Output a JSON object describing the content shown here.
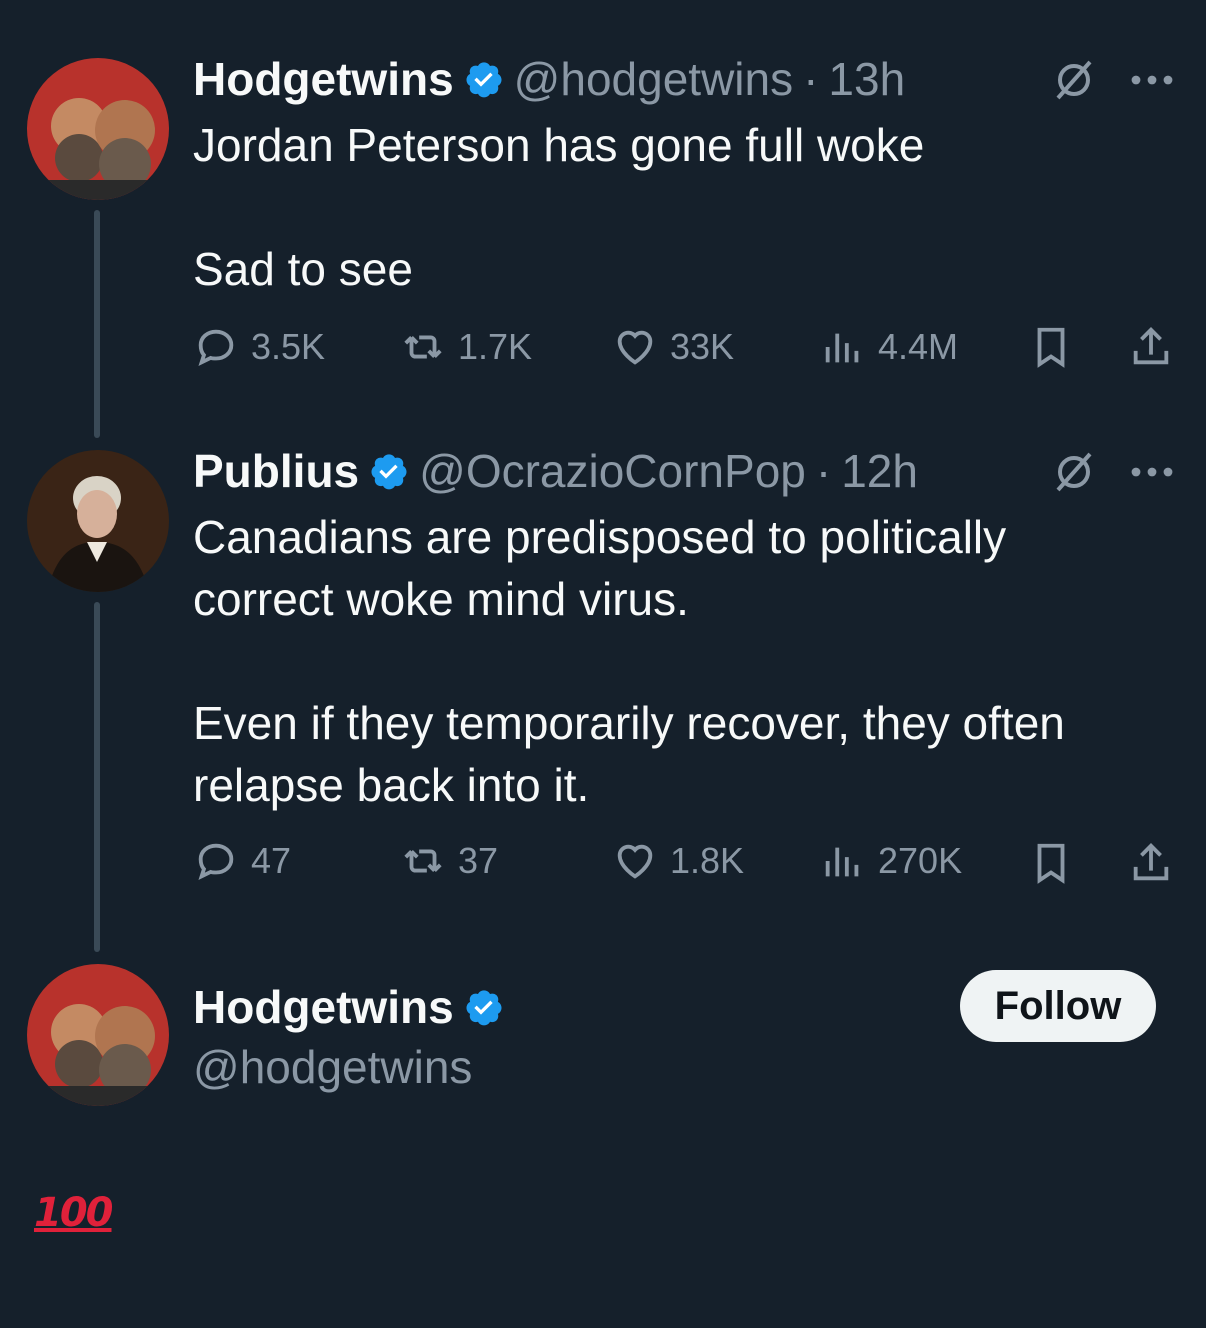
{
  "tweets": [
    {
      "name": "Hodgetwins",
      "handle": "@hodgetwins",
      "time": "13h",
      "text": "Jordan Peterson has gone full woke\n\nSad to see",
      "replies": "3.5K",
      "retweets": "1.7K",
      "likes": "33K",
      "views": "4.4M"
    },
    {
      "name": "Publius",
      "handle": "@OcrazioCornPop",
      "time": "12h",
      "text": "Canadians are predisposed to politically\ncorrect woke mind virus.\n\nEven if they temporarily recover, they often\nrelapse back into it.",
      "replies": "47",
      "retweets": "37",
      "likes": "1.8K",
      "views": "270K"
    }
  ],
  "reply_author": {
    "name": "Hodgetwins",
    "handle": "@hodgetwins",
    "follow_label": "Follow"
  },
  "reply_text": "100",
  "icons": [
    "verified-badge-icon",
    "grok-icon",
    "more-icon",
    "reply-icon",
    "retweet-icon",
    "like-icon",
    "views-icon",
    "bookmark-icon",
    "share-icon",
    "hundred-points-emoji"
  ],
  "colors": {
    "background": "#15202b",
    "muted": "#8b98a5",
    "verified": "#1d9bf0",
    "thread_line": "#3a4a57"
  }
}
